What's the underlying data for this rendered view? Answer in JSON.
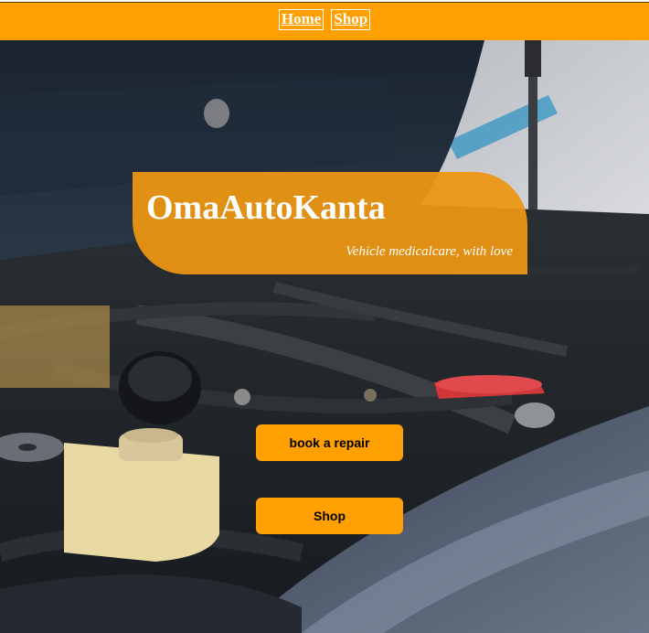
{
  "nav": {
    "items": [
      {
        "label": "Home"
      },
      {
        "label": "Shop"
      }
    ],
    "bar_color": "#ff9f00"
  },
  "hero": {
    "background_image": "car-engine-bay-photo",
    "banner": {
      "title": "OmaAutoKanta",
      "tagline": "Vehicle medicalcare, with love",
      "color": "#ec9612"
    },
    "buttons": {
      "book_repair_label": "book a repair",
      "shop_label": "Shop",
      "color": "#ff9f00"
    }
  }
}
